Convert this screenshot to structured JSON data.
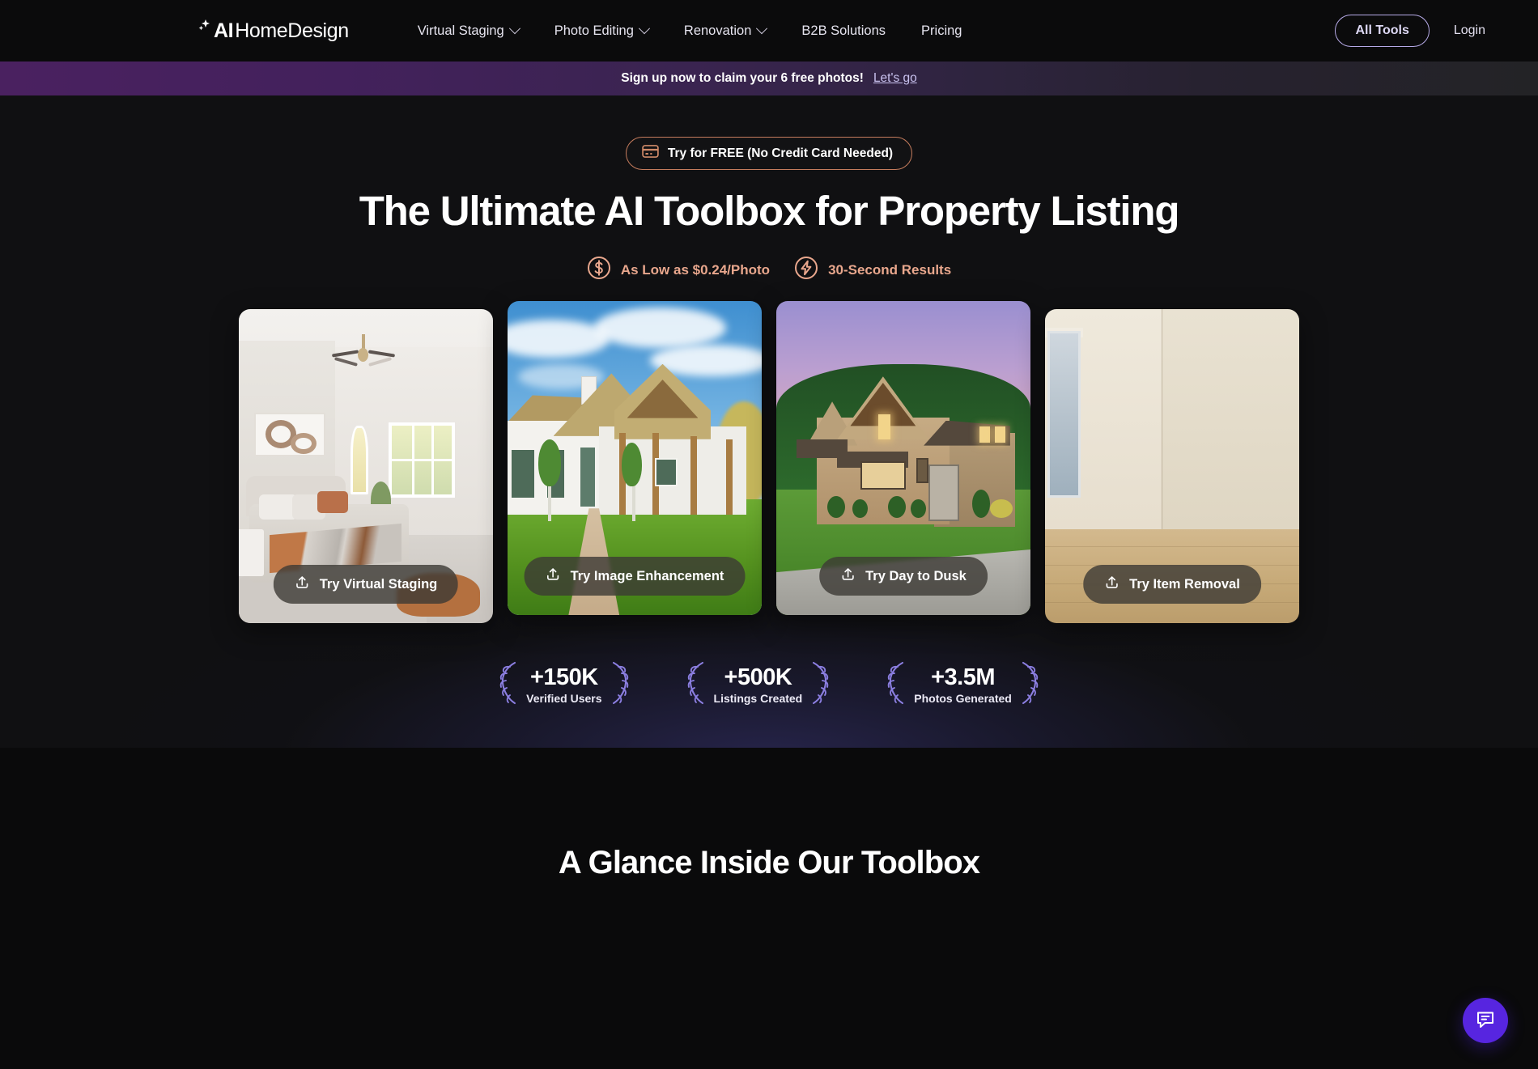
{
  "brand": {
    "name_bold": "AI",
    "name_light": "HomeDesign",
    "logo_icon": "sparkle-icon"
  },
  "nav": {
    "items": [
      {
        "label": "Virtual Staging",
        "has_dropdown": true
      },
      {
        "label": "Photo Editing",
        "has_dropdown": true
      },
      {
        "label": "Renovation",
        "has_dropdown": true
      },
      {
        "label": "B2B Solutions",
        "has_dropdown": false
      },
      {
        "label": "Pricing",
        "has_dropdown": false
      }
    ],
    "all_tools_label": "All Tools",
    "login_label": "Login",
    "all_tools_border_color": "#b7abe8"
  },
  "promo": {
    "text": "Sign up now to claim your 6 free photos!",
    "link_label": "Let's go",
    "gradient_from": "#4a2160",
    "gradient_to": "#232326"
  },
  "hero": {
    "badge": {
      "icon": "credit-card-icon",
      "label": "Try for FREE (No Credit Card Needed)",
      "border_color": "#c57c5d"
    },
    "headline": "The Ultimate AI Toolbox for Property Listing",
    "features": [
      {
        "icon": "dollar-circle-icon",
        "label": "As Low as $0.24/Photo"
      },
      {
        "icon": "lightning-circle-icon",
        "label": "30-Second Results"
      }
    ],
    "feature_color": "#e9a78d",
    "cards": [
      {
        "scene": "staged-bedroom",
        "button_label": "Try Virtual Staging",
        "button_icon": "upload-icon"
      },
      {
        "scene": "enhanced-house-exterior",
        "button_label": "Try Image Enhancement",
        "button_icon": "upload-icon"
      },
      {
        "scene": "dusk-house-exterior",
        "button_label": "Try Day to Dusk",
        "button_icon": "upload-icon"
      },
      {
        "scene": "empty-room",
        "button_label": "Try Item Removal",
        "button_icon": "upload-icon"
      }
    ],
    "stats": [
      {
        "value": "+150K",
        "label": "Verified Users"
      },
      {
        "value": "+500K",
        "label": "Listings Created"
      },
      {
        "value": "+3.5M",
        "label": "Photos Generated"
      }
    ],
    "laurel_color": "#8b7ee0"
  },
  "lower": {
    "heading": "A Glance Inside Our Toolbox"
  },
  "chat": {
    "icon": "chat-bubble-icon",
    "color": "#5725e0"
  }
}
